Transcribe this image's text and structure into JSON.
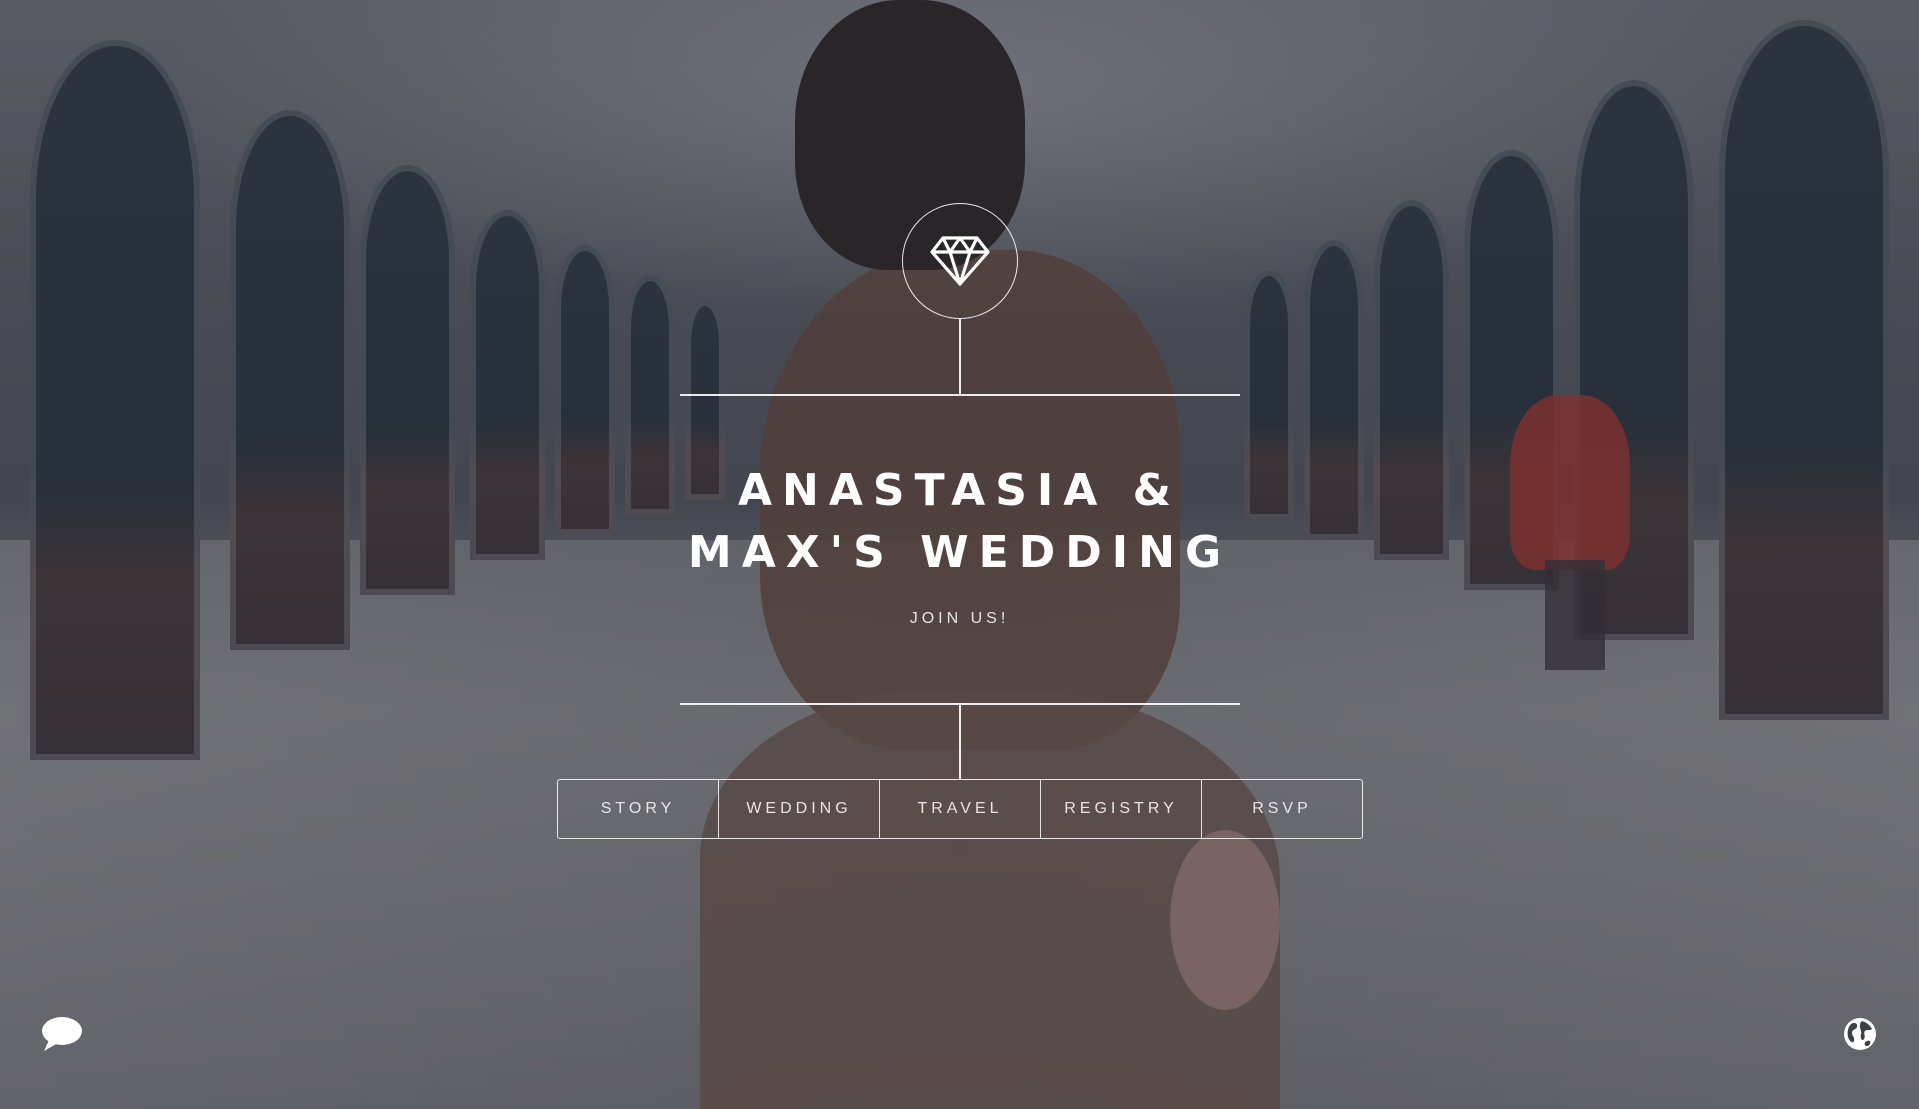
{
  "header": {
    "emblem_icon": "diamond-icon",
    "title_line1": "ANASTASIA &",
    "title_line2": "MAX'S WEDDING",
    "subtitle": "JOIN US!"
  },
  "nav": {
    "items": [
      {
        "label": "STORY"
      },
      {
        "label": "WEDDING"
      },
      {
        "label": "TRAVEL"
      },
      {
        "label": "REGISTRY"
      },
      {
        "label": "RSVP"
      }
    ]
  },
  "footer": {
    "left_icon": "chat-bubble-icon",
    "right_icon": "globe-icon"
  },
  "colors": {
    "foreground": "#ffffff",
    "overlay": "#282a34"
  }
}
